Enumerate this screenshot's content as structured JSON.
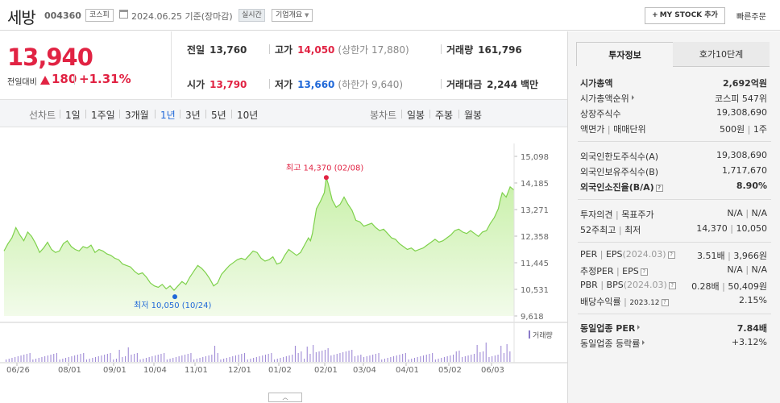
{
  "header": {
    "name": "세방",
    "code": "004360",
    "market": "코스피",
    "date": "2024.06.25",
    "date_suffix": "기준(장마감)",
    "realtime": "실시간",
    "overview": "기업개요",
    "my_stock": "MY STOCK 추가",
    "quick_order": "빠른주문"
  },
  "price": {
    "current": "13,940",
    "change_label": "전일대비",
    "change": "180",
    "change_pct": "+1.31%"
  },
  "quotes": {
    "prev_close_label": "전일",
    "prev_close": "13,760",
    "high_label": "고가",
    "high": "14,050",
    "upper_limit": "(상한가 17,880)",
    "volume_label": "거래량",
    "volume": "161,796",
    "open_label": "시가",
    "open": "13,790",
    "low_label": "저가",
    "low": "13,660",
    "lower_limit": "(하한가 9,640)",
    "amount_label": "거래대금",
    "amount": "2,244",
    "amount_unit": "백만"
  },
  "period_bar": {
    "line_label": "선차트",
    "line_items": [
      "1일",
      "1주일",
      "3개월",
      "1년",
      "3년",
      "5년",
      "10년"
    ],
    "active": "1년",
    "candle_label": "봉차트",
    "candle_items": [
      "일봉",
      "주봉",
      "월봉"
    ]
  },
  "chart_data": {
    "type": "area",
    "x_ticks": [
      "06/26",
      "08/01",
      "09/01",
      "10/04",
      "11/01",
      "12/01",
      "01/02",
      "02/01",
      "03/04",
      "04/01",
      "05/02",
      "06/03"
    ],
    "y_ticks": [
      "15,098",
      "14,185",
      "13,271",
      "12,358",
      "11,445",
      "10,531",
      "9,618"
    ],
    "ylim": [
      9618,
      15098
    ],
    "annotations": {
      "high": "최고 14,370 (02/08)",
      "low": "최저 10,050 (10/24)"
    },
    "volume_legend": "거래량",
    "price_series": [
      [
        0,
        11850
      ],
      [
        2,
        12100
      ],
      [
        4,
        12300
      ],
      [
        6,
        12650
      ],
      [
        8,
        12400
      ],
      [
        10,
        12200
      ],
      [
        12,
        12500
      ],
      [
        14,
        12350
      ],
      [
        16,
        12100
      ],
      [
        18,
        11800
      ],
      [
        20,
        11950
      ],
      [
        22,
        12150
      ],
      [
        24,
        11900
      ],
      [
        26,
        11800
      ],
      [
        28,
        11850
      ],
      [
        30,
        12100
      ],
      [
        32,
        12200
      ],
      [
        34,
        12000
      ],
      [
        36,
        11900
      ],
      [
        38,
        11850
      ],
      [
        40,
        12000
      ],
      [
        42,
        11950
      ],
      [
        44,
        12050
      ],
      [
        46,
        11800
      ],
      [
        48,
        11900
      ],
      [
        50,
        11850
      ],
      [
        52,
        11750
      ],
      [
        54,
        11700
      ],
      [
        56,
        11600
      ],
      [
        58,
        11550
      ],
      [
        60,
        11400
      ],
      [
        62,
        11350
      ],
      [
        64,
        11300
      ],
      [
        66,
        11150
      ],
      [
        68,
        11050
      ],
      [
        70,
        11100
      ],
      [
        72,
        10950
      ],
      [
        74,
        10750
      ],
      [
        76,
        10650
      ],
      [
        78,
        10600
      ],
      [
        80,
        10700
      ],
      [
        82,
        10550
      ],
      [
        84,
        10650
      ],
      [
        86,
        10500
      ],
      [
        88,
        10650
      ],
      [
        90,
        10800
      ],
      [
        92,
        10700
      ],
      [
        94,
        10950
      ],
      [
        96,
        11150
      ],
      [
        98,
        11350
      ],
      [
        100,
        11250
      ],
      [
        102,
        11100
      ],
      [
        104,
        10900
      ],
      [
        106,
        10650
      ],
      [
        108,
        10750
      ],
      [
        110,
        11050
      ],
      [
        112,
        11200
      ],
      [
        114,
        11350
      ],
      [
        116,
        11450
      ],
      [
        118,
        11550
      ],
      [
        120,
        11600
      ],
      [
        122,
        11550
      ],
      [
        124,
        11700
      ],
      [
        126,
        11850
      ],
      [
        128,
        11800
      ],
      [
        130,
        11600
      ],
      [
        132,
        11500
      ],
      [
        134,
        11550
      ],
      [
        136,
        11650
      ],
      [
        138,
        11400
      ],
      [
        140,
        11450
      ],
      [
        142,
        11700
      ],
      [
        144,
        11900
      ],
      [
        146,
        11800
      ],
      [
        148,
        11700
      ],
      [
        150,
        11800
      ],
      [
        152,
        12050
      ],
      [
        154,
        12300
      ],
      [
        155,
        12200
      ],
      [
        156,
        12450
      ],
      [
        158,
        13300
      ],
      [
        160,
        13550
      ],
      [
        162,
        13850
      ],
      [
        163,
        14370
      ],
      [
        164,
        14150
      ],
      [
        166,
        13600
      ],
      [
        168,
        13350
      ],
      [
        170,
        13450
      ],
      [
        172,
        13700
      ],
      [
        174,
        13450
      ],
      [
        176,
        13250
      ],
      [
        178,
        12900
      ],
      [
        180,
        12850
      ],
      [
        182,
        12700
      ],
      [
        184,
        12750
      ],
      [
        186,
        12800
      ],
      [
        188,
        12650
      ],
      [
        190,
        12550
      ],
      [
        192,
        12600
      ],
      [
        194,
        12450
      ],
      [
        196,
        12300
      ],
      [
        198,
        12250
      ],
      [
        200,
        12100
      ],
      [
        202,
        12000
      ],
      [
        204,
        11900
      ],
      [
        206,
        11950
      ],
      [
        208,
        11850
      ],
      [
        210,
        11900
      ],
      [
        212,
        11950
      ],
      [
        214,
        12050
      ],
      [
        216,
        12150
      ],
      [
        218,
        12250
      ],
      [
        220,
        12150
      ],
      [
        222,
        12200
      ],
      [
        224,
        12300
      ],
      [
        226,
        12400
      ],
      [
        228,
        12550
      ],
      [
        230,
        12600
      ],
      [
        232,
        12500
      ],
      [
        234,
        12450
      ],
      [
        236,
        12550
      ],
      [
        238,
        12450
      ],
      [
        240,
        12350
      ],
      [
        242,
        12500
      ],
      [
        244,
        12550
      ],
      [
        246,
        12800
      ],
      [
        248,
        13000
      ],
      [
        250,
        13300
      ],
      [
        251,
        13600
      ],
      [
        252,
        13850
      ],
      [
        254,
        13700
      ],
      [
        256,
        14050
      ],
      [
        258,
        13940
      ]
    ]
  },
  "side_panel": {
    "tab_info": "투자정보",
    "tab_orderbook": "호가10단계",
    "market_cap_label": "시가총액",
    "market_cap": "2,692억원",
    "market_cap_rank_label": "시가총액순위",
    "market_cap_rank": "코스피 547위",
    "shares_label": "상장주식수",
    "shares": "19,308,690",
    "par_label": "액면가",
    "trade_unit_label": "매매단위",
    "par": "500원",
    "trade_unit": "1주",
    "foreign_limit_label": "외국인한도주식수(A)",
    "foreign_limit": "19,308,690",
    "foreign_hold_label": "외국인보유주식수(B)",
    "foreign_hold": "1,717,670",
    "foreign_ratio_label": "외국인소진율(B/A)",
    "foreign_ratio": "8.90%",
    "opinion_label": "투자의견",
    "target_label": "목표주가",
    "opinion": "N/A",
    "target": "N/A",
    "w52_high_label": "52주최고",
    "w52_low_label": "최저",
    "w52_high": "14,370",
    "w52_low": "10,050",
    "per_label": "PER",
    "eps_label": "EPS",
    "eps_period": "(2024.03)",
    "per": "3.51배",
    "eps": "3,966원",
    "est_per_label": "추정PER",
    "est_eps_label": "EPS",
    "est_per": "N/A",
    "est_eps": "N/A",
    "pbr_label": "PBR",
    "bps_label": "BPS",
    "bps_period": "(2024.03)",
    "pbr": "0.28배",
    "bps": "50,409원",
    "div_label": "배당수익률",
    "div_period": "2023.12",
    "div": "2.15%",
    "sector_per_label": "동일업종 PER",
    "sector_per": "7.84배",
    "sector_chg_label": "동일업종 등락률",
    "sector_chg": "+3.12%"
  }
}
